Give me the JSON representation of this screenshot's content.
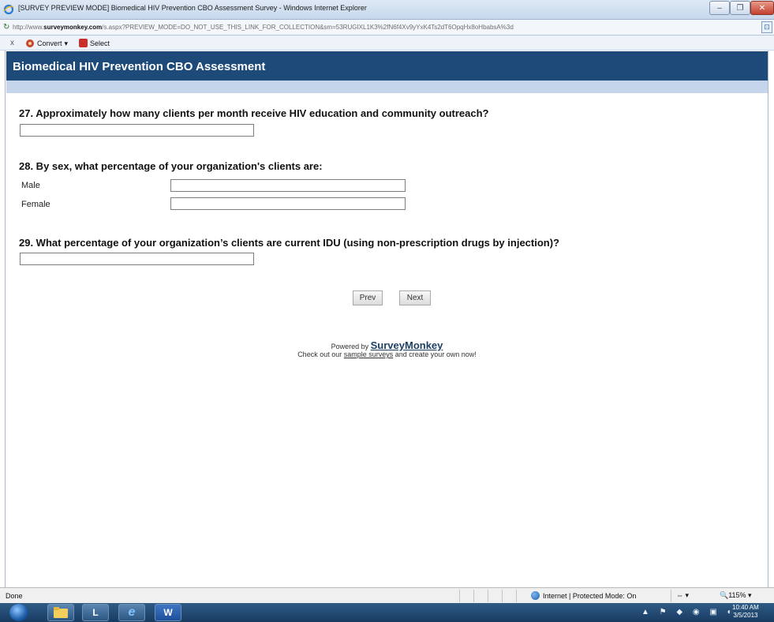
{
  "window": {
    "title": "[SURVEY PREVIEW MODE] Biomedical HIV Prevention CBO Assessment Survey - Windows Internet Explorer",
    "minimize_label": "–",
    "maximize_label": "❐",
    "close_label": "✕"
  },
  "address": {
    "prefix": "http://www.",
    "domain": "surveymonkey.com",
    "path": "/s.aspx?PREVIEW_MODE=DO_NOT_USE_THIS_LINK_FOR_COLLECTION&sm=53RUGIXL1K3%2fN6f4Xv9yYxK4Ts2dT6OpqHx8oHbabsA%3d"
  },
  "command_bar": {
    "close_label": "x",
    "convert_label": "Convert",
    "convert_arrow": "▾",
    "select_label": "Select"
  },
  "survey": {
    "banner_title": "Biomedical HIV Prevention CBO Assessment",
    "questions": [
      {
        "label": "27. Approximately how many clients per month receive HIV education and community outreach?"
      },
      {
        "label": "28. By sex, what percentage of your organization's clients are:",
        "rows": [
          "Male",
          "Female"
        ]
      },
      {
        "label": "29. What percentage of your organization’s clients are current IDU (using non-prescription drugs by injection)?"
      }
    ],
    "prev_label": "Prev",
    "next_label": "Next",
    "powered_by": "Powered by ",
    "brand": "SurveyMonkey",
    "checkout_prefix": "Check out our ",
    "checkout_link": "sample surveys",
    "checkout_suffix": " and create your own now!"
  },
  "status": {
    "left": "Done",
    "zone": "Internet | Protected Mode: On",
    "zoom_ctl": "♒ ▾",
    "zoom": "🔍115%  ▾"
  },
  "taskbar": {
    "word_label": "W",
    "ie_label": "e",
    "lync_label": "L",
    "tray_icons": "▲ ⚑ ◆ ◉ ▣ ◐",
    "time": "10:40 AM",
    "date": "3/5/2013"
  },
  "colors": {
    "banner": "#1e4a79",
    "subbanner": "#c5d6ec",
    "taskbar": "#1e4670"
  }
}
